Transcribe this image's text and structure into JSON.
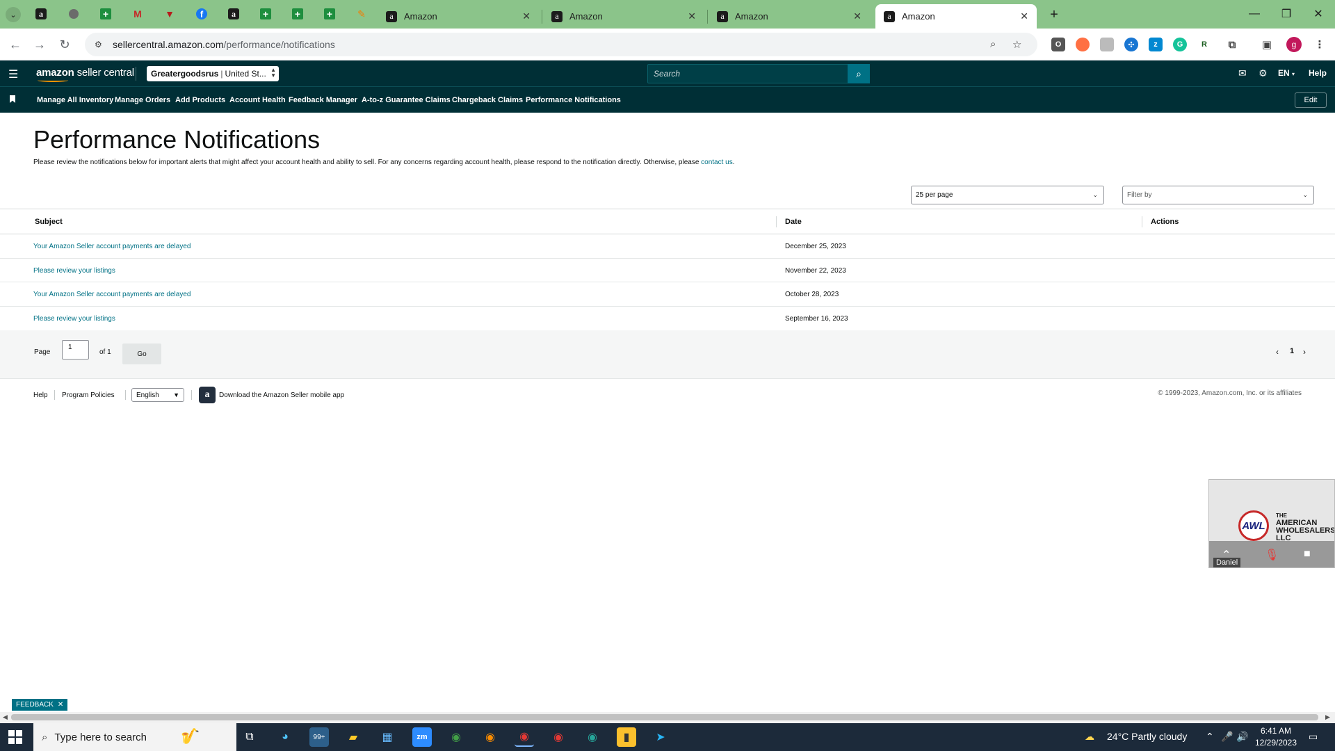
{
  "browser": {
    "tabs": [
      {
        "title": "Amazon"
      },
      {
        "title": "Amazon"
      },
      {
        "title": "Amazon"
      },
      {
        "title": "Amazon",
        "active": true
      }
    ],
    "url_host": "sellercentral.amazon.com",
    "url_path": "/performance/notifications",
    "profile_initial": "g"
  },
  "header": {
    "logo_bold": "amazon",
    "logo_rest": " seller central",
    "account_name": "Greatergoodsrus",
    "account_region": "United St...",
    "search_placeholder": "Search",
    "lang": "EN",
    "help": "Help"
  },
  "nav": {
    "items": [
      "Manage All Inventory",
      "Manage Orders",
      "Add Products",
      "Account Health",
      "Feedback Manager",
      "A-to-z Guarantee Claims",
      "Chargeback Claims",
      "Performance Notifications"
    ],
    "edit_label": "Edit"
  },
  "page": {
    "title": "Performance Notifications",
    "intro": "Please review the notifications below for important alerts that might affect your account health and ability to sell. For any concerns regarding account health, please respond to the notification directly. Otherwise, please ",
    "intro_link": "contact us",
    "intro_end": ".",
    "per_page": "25 per page",
    "filter_placeholder": "Filter by"
  },
  "table": {
    "columns": [
      "Subject",
      "Date",
      "Actions"
    ],
    "rows": [
      {
        "subject": "Your Amazon Seller account payments are delayed",
        "date": "December 25, 2023"
      },
      {
        "subject": "Please review your listings",
        "date": "November 22, 2023"
      },
      {
        "subject": "Your Amazon Seller account payments are delayed",
        "date": "October 28, 2023"
      },
      {
        "subject": "Please review your listings",
        "date": "September 16, 2023"
      }
    ]
  },
  "pager": {
    "page_label": "Page",
    "page_value": "1",
    "of_label": "of 1",
    "go_label": "Go",
    "current_page": "1"
  },
  "footer": {
    "help": "Help",
    "program_policies": "Program Policies",
    "language": "English",
    "download_app": "Download the Amazon Seller mobile app",
    "copyright": "© 1999-2023, Amazon.com, Inc. or its affiliates"
  },
  "zoom": {
    "logo": "AWL",
    "company_lines": [
      "THE",
      "AMERICAN",
      "WHOLESALERS",
      "LLC"
    ],
    "participant": "Daniel"
  },
  "feedback": {
    "label": "FEEDBACK"
  },
  "taskbar": {
    "search_placeholder": "Type here to search",
    "weather": "24°C  Partly cloudy",
    "time": "6:41 AM",
    "date": "12/29/2023",
    "badge_count": "99+"
  },
  "colors": {
    "tabstrip": "#8bc48a",
    "header_bg": "#002f36",
    "link": "#007185",
    "search_btn": "#007185"
  }
}
